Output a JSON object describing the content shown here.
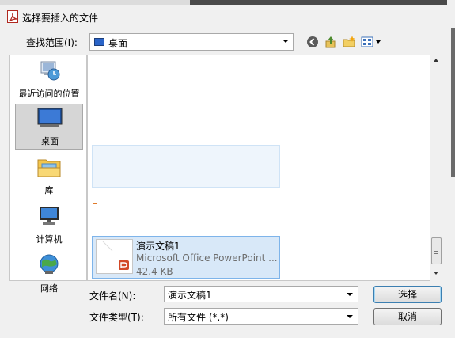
{
  "window": {
    "title": "选择要插入的文件"
  },
  "toolbar": {
    "look_in_label": "查找范围(I):",
    "look_in_value": "桌面"
  },
  "sidebar": {
    "items": [
      {
        "label": "最近访问的位置",
        "icon": "recent-places-icon"
      },
      {
        "label": "桌面",
        "icon": "desktop-icon",
        "selected": true
      },
      {
        "label": "库",
        "icon": "library-icon"
      },
      {
        "label": "计算机",
        "icon": "computer-icon"
      },
      {
        "label": "网络",
        "icon": "network-icon"
      }
    ]
  },
  "files": {
    "selected_item": {
      "name": "演示文稿1",
      "type": "Microsoft Office PowerPoint ...",
      "size": "42.4 KB"
    }
  },
  "bottom": {
    "filename_label": "文件名(N):",
    "filename_value": "演示文稿1",
    "filetype_label": "文件类型(T):",
    "filetype_value": "所有文件 (*.*)",
    "select_button": "选择",
    "cancel_button": "取消"
  },
  "colors": {
    "accent": "#3c7fb1",
    "selection": "#d8e8f8",
    "pdf_red": "#b0281f"
  }
}
